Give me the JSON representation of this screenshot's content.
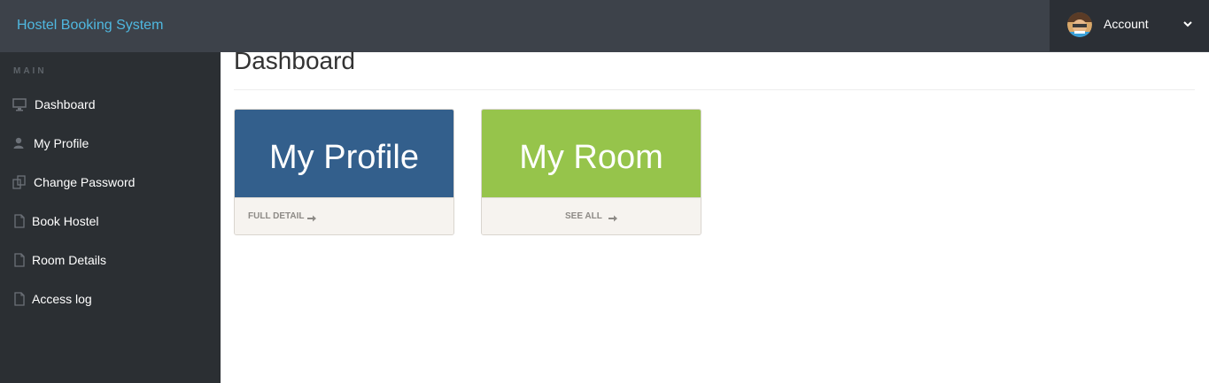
{
  "header": {
    "brand": "Hostel Booking System",
    "account_label": "Account"
  },
  "sidebar": {
    "heading": "MAIN",
    "items": [
      {
        "label": "Dashboard",
        "icon": "monitor-icon"
      },
      {
        "label": "My Profile",
        "icon": "user-icon"
      },
      {
        "label": "Change Password",
        "icon": "files-icon"
      },
      {
        "label": "Book Hostel",
        "icon": "file-icon"
      },
      {
        "label": "Room Details",
        "icon": "file-icon"
      },
      {
        "label": "Access log",
        "icon": "file-icon"
      }
    ]
  },
  "main": {
    "title": "Dashboard",
    "cards": [
      {
        "title": "My Profile",
        "footer": "FULL DETAIL",
        "color": "#335f8c"
      },
      {
        "title": "My Room",
        "footer": "SEE ALL",
        "color": "#96c44b"
      }
    ]
  },
  "colors": {
    "topbar": "#3d424a",
    "brand": "#4fb8e0",
    "sidebar": "#2b2f33",
    "account_bg": "#2b2f35"
  }
}
